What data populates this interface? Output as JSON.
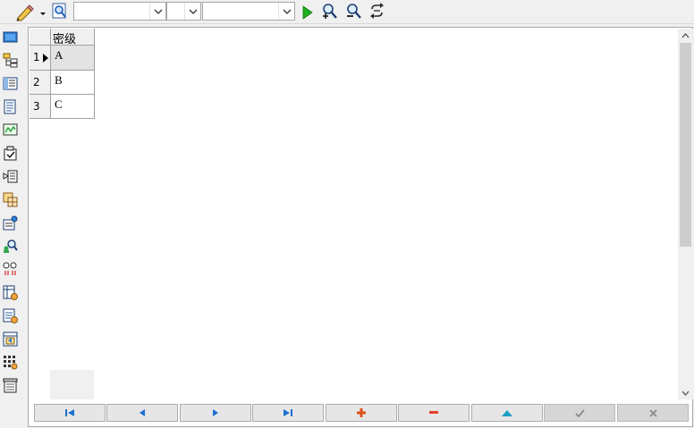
{
  "toolbar": {
    "filter_value_1": "",
    "filter_value_2": "",
    "filter_value_3": ""
  },
  "grid": {
    "column_header": "密级",
    "rows": [
      {
        "num": "1",
        "value": "A"
      },
      {
        "num": "2",
        "value": "B"
      },
      {
        "num": "3",
        "value": "C"
      }
    ]
  },
  "colors": {
    "run_green": "#1fb01f",
    "nav_blue": "#1e6fd0",
    "add_red": "#d9531c",
    "delete_red": "#e5402a",
    "up_teal": "#1a9fc7"
  }
}
